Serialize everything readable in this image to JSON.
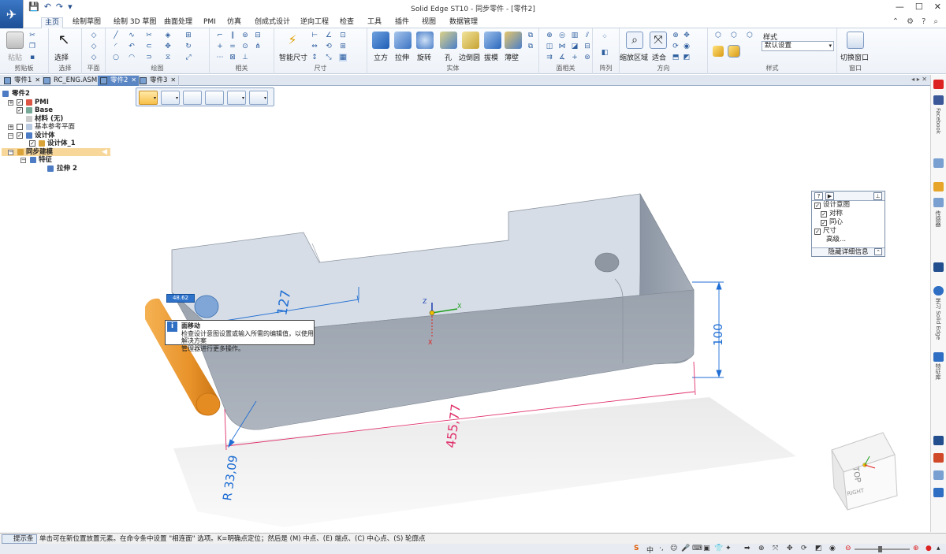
{
  "window": {
    "title": "Solid Edge ST10 - 同步零件 - [零件2]"
  },
  "qat": {
    "save": "💾",
    "undo": "↶",
    "redo": "↷"
  },
  "ribbon_tabs": [
    "主页",
    "绘制草图",
    "绘制 3D 草图",
    "曲面处理",
    "PMI",
    "仿真",
    "创成式设计",
    "逆向工程",
    "检查",
    "工具",
    "插件",
    "视图",
    "数据管理"
  ],
  "ribbon": {
    "clipboard": {
      "paste": "粘贴",
      "label": "剪贴板"
    },
    "select": {
      "select": "选择",
      "label": "选择"
    },
    "plane": {
      "label": "平面"
    },
    "draw": {
      "label": "绘图"
    },
    "relate": {
      "label": "相关"
    },
    "dimension": {
      "smart": "智能尺寸",
      "label": "尺寸"
    },
    "solids": {
      "block": "立方",
      "extrude": "拉伸",
      "revolve": "旋转",
      "hole": "孔",
      "round": "边倒圆",
      "draft": "拔模",
      "thin": "薄壁",
      "label": "实体"
    },
    "face_relate": {
      "label": "面相关"
    },
    "pattern": {
      "label": "阵列"
    },
    "orient": {
      "zoom_area": "缩放区域",
      "fit": "适合",
      "label": "方向"
    },
    "style": {
      "style": "样式",
      "default": "默认设置",
      "label": "样式"
    },
    "window": {
      "switch": "切换窗口",
      "label": "窗口"
    }
  },
  "doc_tabs": [
    "零件1",
    "RC_ENG.ASM",
    "零件2",
    "零件3"
  ],
  "pathfinder": {
    "root": "零件2",
    "pmi": "PMI",
    "base": "Base",
    "material": "材料 (无)",
    "ref_planes": "基本参考平面",
    "design_body": "设计体",
    "design_body_1": "设计体_1",
    "sync": "同步建模",
    "features": "特征",
    "extrude2": "拉伸 2"
  },
  "intent": {
    "design_intent": "设计意图",
    "symmetric": "对称",
    "concentric": "同心",
    "dimension": "尺寸",
    "advanced": "高级...",
    "hide": "隐藏详细信息"
  },
  "tooltip": {
    "title": "面移动",
    "line1": "检查设计意图设置或输入所需的编辑值，以使用解决方案",
    "line2": "管理器进行更多操作。"
  },
  "valbox": "48.62",
  "dims": {
    "d127": "127",
    "d100": "100",
    "d455": "455,77",
    "r33": "R 33,09"
  },
  "axes": {
    "z": "Z",
    "x": "X"
  },
  "viewcube": {
    "top": "TOP",
    "right": "RIGHT"
  },
  "status": {
    "label": "提示条",
    "msg": "单击可在新位置放置元素。在命令条中设置 \"相连面\" 选项。K=明确点定位；然后是 (M) 中点、(E) 端点、(C) 中心点、(S) 轮廓点"
  },
  "rightbar": {
    "facebook": "Facebook",
    "learn": "学习 Solid Edge",
    "r1": "传感器",
    "r2": "特征库"
  },
  "colors": {
    "accent": "#5b86c4",
    "body": "#b5bdc7",
    "top_face": "#d7dee6",
    "cylinder": "#e8922a",
    "dim_blue": "#1f6ed4",
    "dim_pink": "#e0306a"
  }
}
